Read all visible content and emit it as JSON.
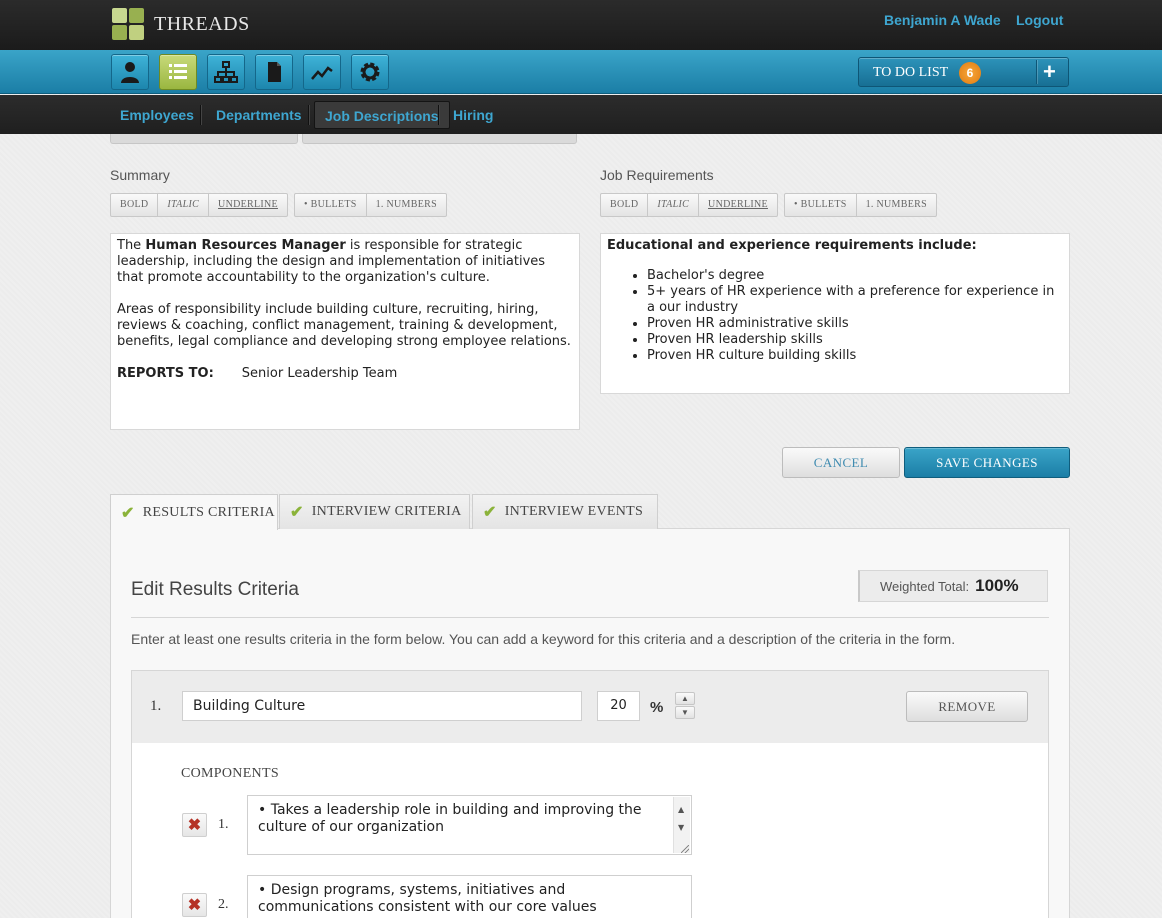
{
  "app": {
    "name": "THREADS"
  },
  "header": {
    "user_name": "Benjamin A Wade",
    "logout_label": "Logout"
  },
  "toolbar": {
    "icons": [
      "person-icon",
      "list-icon",
      "org-chart-icon",
      "document-icon",
      "trend-chart-icon",
      "gear-icon"
    ],
    "active_icon": "list-icon",
    "todo": {
      "label": "TO DO LIST",
      "count": "6",
      "add_symbol": "+"
    }
  },
  "subnav": {
    "items": [
      {
        "label": "Employees"
      },
      {
        "label": "Departments"
      },
      {
        "label": "Job Descriptions",
        "active": true
      },
      {
        "label": "Hiring"
      }
    ]
  },
  "format_buttons": {
    "bold": "BOLD",
    "italic": "ITALIC",
    "underline": "UNDERLINE",
    "bullets": "• BULLETS",
    "numbers": "1. NUMBERS"
  },
  "summary": {
    "label": "Summary",
    "p1_pre": "The ",
    "p1_bold": "Human Resources Manager",
    "p1_post": " is responsible for strategic leadership, including the design and implementation of initiatives that promote accountability to the organization's culture.",
    "p2": "Areas of responsibility include building culture, recruiting, hiring, reviews & coaching, conflict management, training & development, benefits, legal compliance and developing strong employee relations.",
    "reports_label": "REPORTS TO:",
    "reports_value": "Senior Leadership Team"
  },
  "requirements": {
    "label": "Job Requirements",
    "heading": "Educational and experience requirements include:",
    "items": [
      "Bachelor's degree",
      "5+ years of HR experience with a preference for experience in a our industry",
      "Proven HR administrative skills",
      "Proven HR leadership skills",
      "Proven HR culture building skills"
    ]
  },
  "actions": {
    "cancel": "CANCEL",
    "save": "SAVE CHANGES"
  },
  "tabs": [
    {
      "label": "RESULTS CRITERIA",
      "active": true
    },
    {
      "label": "INTERVIEW CRITERIA"
    },
    {
      "label": "INTERVIEW EVENTS"
    }
  ],
  "results": {
    "title": "Edit Results Criteria",
    "weighted_label": "Weighted Total:",
    "weighted_value": "100%",
    "instructions": "Enter at least one results criteria in the form below. You can add a keyword for this criteria and a description of the criteria in the form.",
    "criterion": {
      "number": "1.",
      "name": "Building Culture",
      "weight": "20",
      "unit": "%",
      "remove_label": "REMOVE",
      "components_label": "COMPONENTS",
      "components": [
        {
          "number": "1.",
          "text": "• Takes a leadership role in building and improving the culture of our organization"
        },
        {
          "number": "2.",
          "text": "• Design programs, systems, initiatives and communications consistent with our core values"
        }
      ]
    }
  },
  "colors": {
    "brand_blue": "#1b7ea6",
    "accent_green": "#9ab640",
    "badge_orange": "#e07b10",
    "link_blue": "#3ea6d0",
    "delete_red": "#b53226"
  }
}
